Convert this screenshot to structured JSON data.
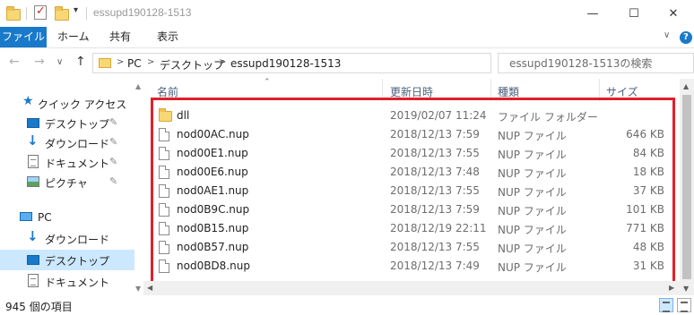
{
  "window": {
    "title": "essupd190128-1513",
    "controls": {
      "minimize": "—",
      "maximize": "☐",
      "close": "✕"
    }
  },
  "ribbon": {
    "tabs": [
      "ファイル",
      "ホーム",
      "共有",
      "表示"
    ],
    "expand_icon": "chevron-down-icon",
    "help_icon": "?"
  },
  "address": {
    "back": "←",
    "forward": "→",
    "recent": "∨",
    "up": "↑",
    "segments": [
      "PC",
      "デスクトップ",
      "essupd190128-1513"
    ],
    "separator": ">",
    "refresh": "↻",
    "search_placeholder": "essupd190128-1513の検索"
  },
  "navigation": {
    "items": [
      {
        "label": "クイック アクセス",
        "icon": "star-icon"
      },
      {
        "label": "デスクトップ",
        "icon": "desktop-icon",
        "pinned": true
      },
      {
        "label": "ダウンロード",
        "icon": "download-icon",
        "pinned": true
      },
      {
        "label": "ドキュメント",
        "icon": "document-icon",
        "pinned": true
      },
      {
        "label": "ピクチャ",
        "icon": "pictures-icon",
        "pinned": true
      },
      {
        "label": "PC",
        "icon": "pc-icon"
      },
      {
        "label": "ダウンロード",
        "icon": "download-icon"
      },
      {
        "label": "デスクトップ",
        "icon": "desktop-icon",
        "selected": true
      },
      {
        "label": "ドキュメント",
        "icon": "document-icon"
      }
    ],
    "pin_glyph": "📌"
  },
  "columns": [
    "名前",
    "更新日時",
    "種類",
    "サイズ"
  ],
  "files": [
    {
      "name": "dll",
      "modified": "2019/02/07 11:24",
      "type": "ファイル フォルダー",
      "size": "",
      "kind": "folder"
    },
    {
      "name": "nod00AC.nup",
      "modified": "2018/12/13 7:59",
      "type": "NUP ファイル",
      "size": "646 KB",
      "kind": "file"
    },
    {
      "name": "nod00E1.nup",
      "modified": "2018/12/13 7:55",
      "type": "NUP ファイル",
      "size": "84 KB",
      "kind": "file"
    },
    {
      "name": "nod00E6.nup",
      "modified": "2018/12/13 7:48",
      "type": "NUP ファイル",
      "size": "18 KB",
      "kind": "file"
    },
    {
      "name": "nod0AE1.nup",
      "modified": "2018/12/13 7:55",
      "type": "NUP ファイル",
      "size": "37 KB",
      "kind": "file"
    },
    {
      "name": "nod0B9C.nup",
      "modified": "2018/12/13 7:59",
      "type": "NUP ファイル",
      "size": "101 KB",
      "kind": "file"
    },
    {
      "name": "nod0B15.nup",
      "modified": "2018/12/19 22:11",
      "type": "NUP ファイル",
      "size": "771 KB",
      "kind": "file"
    },
    {
      "name": "nod0B57.nup",
      "modified": "2018/12/13 7:55",
      "type": "NUP ファイル",
      "size": "48 KB",
      "kind": "file"
    },
    {
      "name": "nod0BD8.nup",
      "modified": "2018/12/13 7:49",
      "type": "NUP ファイル",
      "size": "31 KB",
      "kind": "file"
    }
  ],
  "status": {
    "item_count": "945 個の項目"
  },
  "colors": {
    "accent": "#1979ca",
    "highlight_border": "#e0202a",
    "selected_bg": "#cce8ff"
  }
}
